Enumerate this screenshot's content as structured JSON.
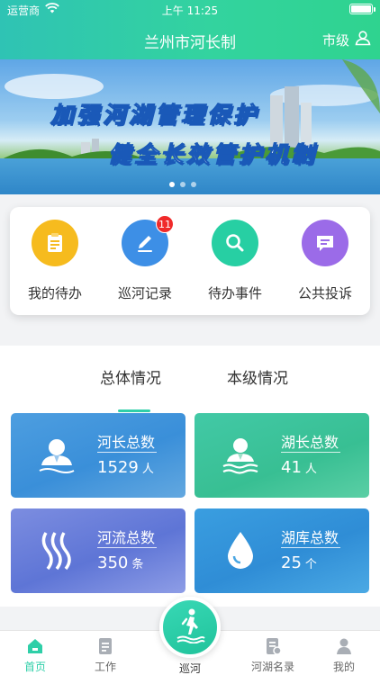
{
  "status_bar": {
    "carrier": "运营商",
    "time": "上午 11:25"
  },
  "nav": {
    "title": "兰州市河长制",
    "level": "市级"
  },
  "banner": {
    "line1": "加强河湖管理保护",
    "line2": "健全长效管护机制"
  },
  "quick_actions": [
    {
      "label": "我的待办",
      "icon": "clipboard-icon",
      "color": "#f6bb1e"
    },
    {
      "label": "巡河记录",
      "icon": "edit-icon",
      "color": "#3d8fe6",
      "badge": "11"
    },
    {
      "label": "待办事件",
      "icon": "search-icon",
      "color": "#27cfa3"
    },
    {
      "label": "公共投诉",
      "icon": "message-icon",
      "color": "#9b6be8"
    }
  ],
  "tabs": [
    "总体情况",
    "本级情况"
  ],
  "cards": [
    {
      "title": "河长总数",
      "value": "1529",
      "unit": "人"
    },
    {
      "title": "湖长总数",
      "value": "41",
      "unit": "人"
    },
    {
      "title": "河流总数",
      "value": "350",
      "unit": "条"
    },
    {
      "title": "湖库总数",
      "value": "25",
      "unit": "个"
    }
  ],
  "tabbar": [
    "首页",
    "工作",
    "巡河",
    "河湖名录",
    "我的"
  ],
  "colors": {
    "accent": "#2fcfa8",
    "badge": "#f02a2a"
  }
}
